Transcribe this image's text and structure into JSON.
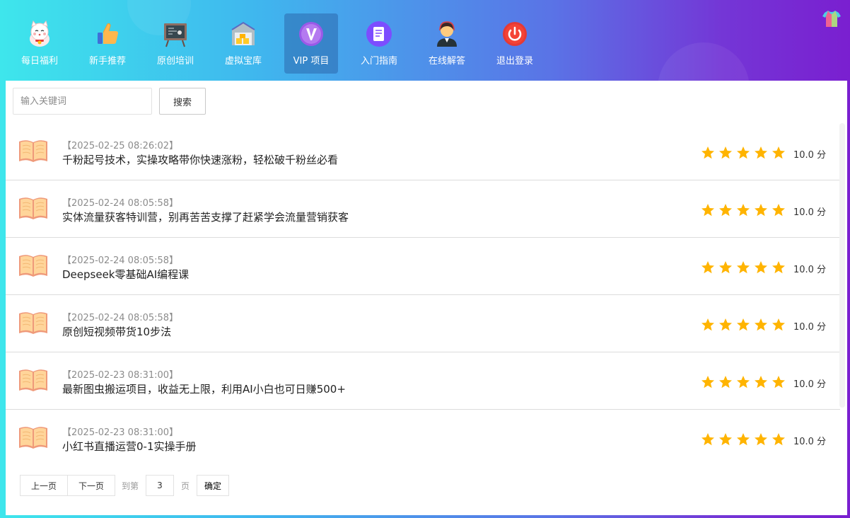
{
  "colors": {
    "star": "#ffb400",
    "active_nav_bg": "#3a6aa8",
    "book_icon": "#f0a070"
  },
  "nav": {
    "items": [
      {
        "label": "每日福利",
        "icon": "lucky-cat-icon"
      },
      {
        "label": "新手推荐",
        "icon": "thumbs-up-icon"
      },
      {
        "label": "原创培训",
        "icon": "blackboard-icon"
      },
      {
        "label": "虚拟宝库",
        "icon": "warehouse-icon"
      },
      {
        "label": "VIP 项目",
        "icon": "vip-icon",
        "active": true
      },
      {
        "label": "入门指南",
        "icon": "document-icon"
      },
      {
        "label": "在线解答",
        "icon": "support-agent-icon"
      },
      {
        "label": "退出登录",
        "icon": "power-icon"
      }
    ],
    "theme_icon": "shirt-icon"
  },
  "search": {
    "placeholder": "输入关键词",
    "value": "",
    "button_label": "搜索"
  },
  "list": {
    "items": [
      {
        "date": "【2025-02-25 08:26:02】",
        "title": "千粉起号技术，实操攻略带你快速涨粉，轻松破千粉丝必看",
        "rating": 5,
        "score": "10.0 分"
      },
      {
        "date": "【2025-02-24 08:05:58】",
        "title": "实体流量获客特训营，别再苦苦支撑了赶紧学会流量营销获客",
        "rating": 5,
        "score": "10.0 分"
      },
      {
        "date": "【2025-02-24 08:05:58】",
        "title": "Deepseek零基础AI编程课",
        "rating": 5,
        "score": "10.0 分"
      },
      {
        "date": "【2025-02-24 08:05:58】",
        "title": "原创短视频带货10步法",
        "rating": 5,
        "score": "10.0 分"
      },
      {
        "date": "【2025-02-23 08:31:00】",
        "title": "最新图虫搬运项目，收益无上限，利用AI小白也可日赚500+",
        "rating": 5,
        "score": "10.0 分"
      },
      {
        "date": "【2025-02-23 08:31:00】",
        "title": "小红书直播运营0-1实操手册",
        "rating": 5,
        "score": "10.0 分"
      }
    ]
  },
  "pager": {
    "prev_label": "上一页",
    "next_label": "下一页",
    "goto_label": "到第",
    "page_value": "3",
    "page_unit": "页",
    "confirm_label": "确定"
  }
}
